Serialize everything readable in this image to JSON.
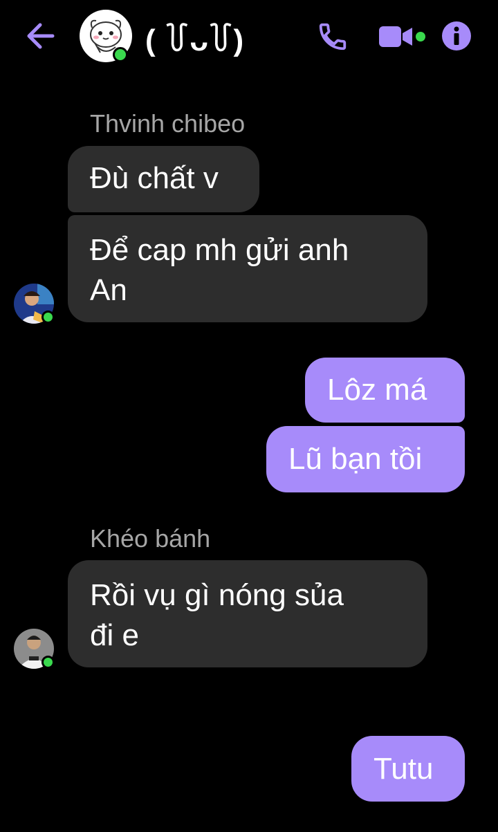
{
  "header": {
    "title": "( ꒦ᴗ꒦)",
    "back_icon": "arrow-left-icon",
    "call_icon": "phone-icon",
    "video_icon": "video-camera-icon",
    "info_icon": "info-icon",
    "accent_color": "#a78bfa",
    "online_color": "#3ad94e"
  },
  "messages": [
    {
      "sender": "Thvinh chibeo",
      "direction": "incoming",
      "lines": [
        "Đù chất v"
      ]
    },
    {
      "sender": "Thvinh chibeo",
      "direction": "incoming",
      "lines": [
        "Để cap mh gửi anh",
        "An"
      ]
    },
    {
      "direction": "outgoing",
      "lines": [
        "Lôz má"
      ]
    },
    {
      "direction": "outgoing",
      "lines": [
        "Lũ bạn tồi"
      ]
    },
    {
      "sender": "Khéo bánh",
      "direction": "incoming",
      "lines": [
        "Rồi vụ gì nóng sủa",
        "đi e"
      ]
    },
    {
      "direction": "outgoing",
      "lines": [
        "Tutu"
      ]
    }
  ]
}
